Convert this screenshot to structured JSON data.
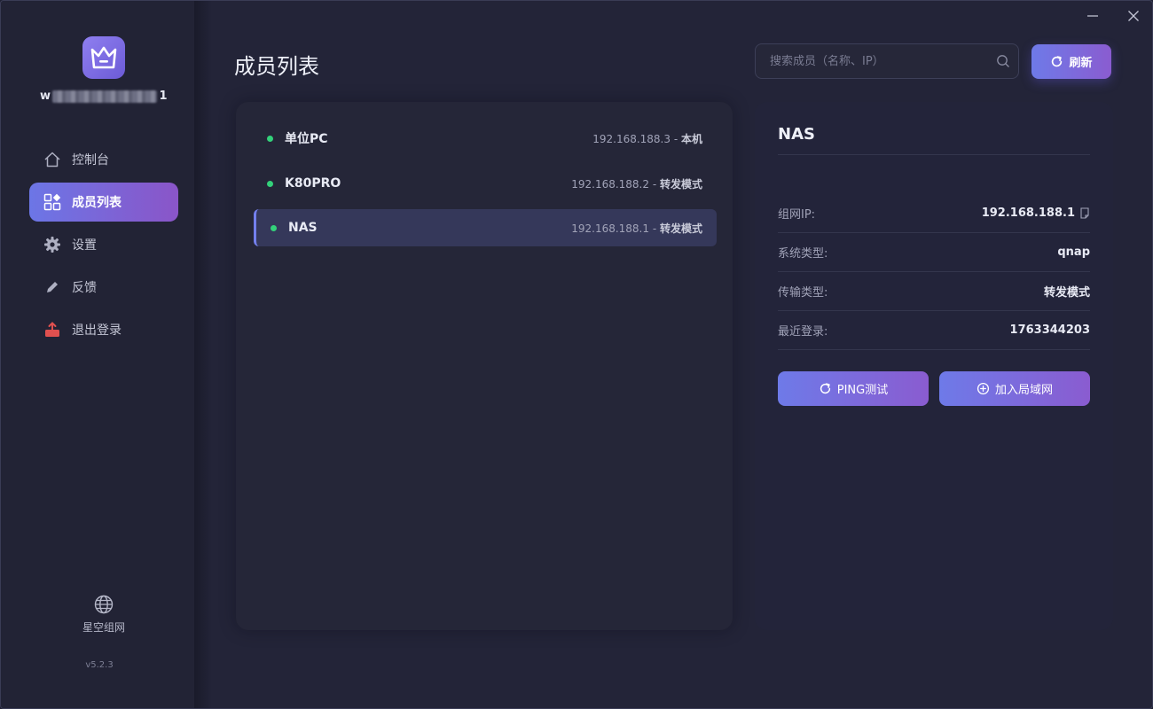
{
  "user": {
    "name_prefix": "w",
    "name_suffix": "1"
  },
  "sidebar": {
    "items": [
      {
        "label": "控制台",
        "icon": "home-icon",
        "active": false
      },
      {
        "label": "成员列表",
        "icon": "grid-icon",
        "active": true
      },
      {
        "label": "设置",
        "icon": "gear-icon",
        "active": false
      },
      {
        "label": "反馈",
        "icon": "pencil-icon",
        "active": false
      },
      {
        "label": "退出登录",
        "icon": "logout-icon",
        "active": false
      }
    ],
    "brand": "星空组网",
    "version": "v5.2.3"
  },
  "header": {
    "title": "成员列表",
    "search_placeholder": "搜索成员（名称、IP）",
    "refresh_label": "刷新"
  },
  "members": [
    {
      "name": "单位PC",
      "ip": "192.168.188.3",
      "sep": " - ",
      "mode": "本机",
      "online": true
    },
    {
      "name": "K80PRO",
      "ip": "192.168.188.2",
      "sep": " - ",
      "mode": "转发模式",
      "online": true
    },
    {
      "name": "NAS",
      "ip": "192.168.188.1",
      "sep": " - ",
      "mode": "转发模式",
      "online": true,
      "selected": true
    }
  ],
  "detail": {
    "title": "NAS",
    "rows": [
      {
        "label": "组网IP:",
        "value": "192.168.188.1"
      },
      {
        "label": "系统类型:",
        "value": "qnap"
      },
      {
        "label": "传输类型:",
        "value": "转发模式"
      },
      {
        "label": "最近登录:",
        "value": "1763344203"
      }
    ],
    "ping_label": "PING测试",
    "join_label": "加入局域网"
  },
  "colors": {
    "accent_start": "#6e7ae8",
    "accent_end": "#8a5cd0",
    "online": "#33d17a",
    "background": "#232438"
  }
}
